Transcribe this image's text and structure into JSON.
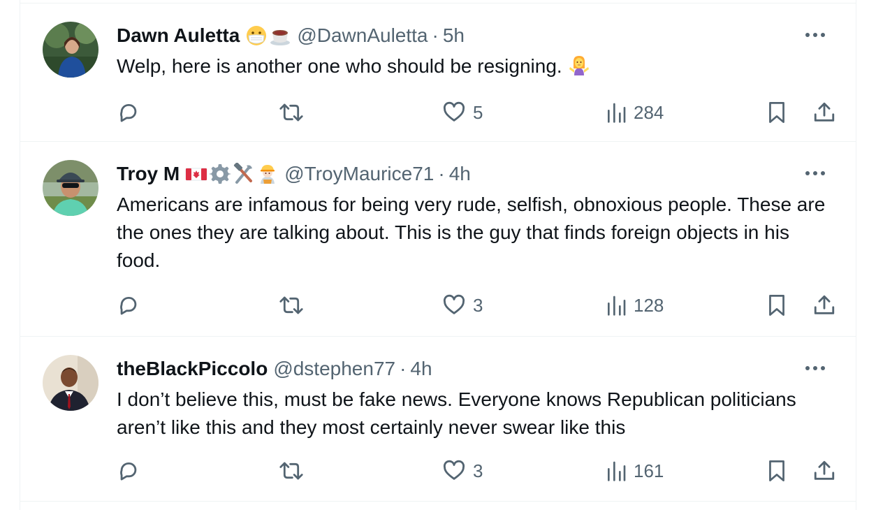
{
  "colors": {
    "text": "#0f1419",
    "secondary": "#536471",
    "border": "#eff3f4"
  },
  "tweets": [
    {
      "name": "Dawn Auletta",
      "name_emojis": [
        "face-with-medical-mask-emoji",
        "hot-beverage-emoji"
      ],
      "handle": "@DawnAuletta",
      "dot": "·",
      "time": "5h",
      "text": "Welp, here is another one who should be resigning.",
      "text_emoji": "person-shrugging-emoji",
      "likes": "5",
      "views": "284"
    },
    {
      "name": "Troy M",
      "name_emojis": [
        "canada-flag-emoji",
        "gear-emoji",
        "hammer-and-wrench-emoji",
        "construction-worker-emoji"
      ],
      "handle": "@TroyMaurice71",
      "dot": "·",
      "time": "4h",
      "text": "Americans are infamous for being very rude, selfish, obnoxious people. These are the ones they are talking about. This is the guy that finds foreign objects in his food.",
      "likes": "3",
      "views": "128"
    },
    {
      "name": "theBlackPiccolo",
      "handle": "@dstephen77",
      "dot": "·",
      "time": "4h",
      "text": "I don’t believe this, must be fake news. Everyone knows Republican politicians aren’t like this and they most certainly never swear like this",
      "likes": "3",
      "views": "161"
    }
  ]
}
